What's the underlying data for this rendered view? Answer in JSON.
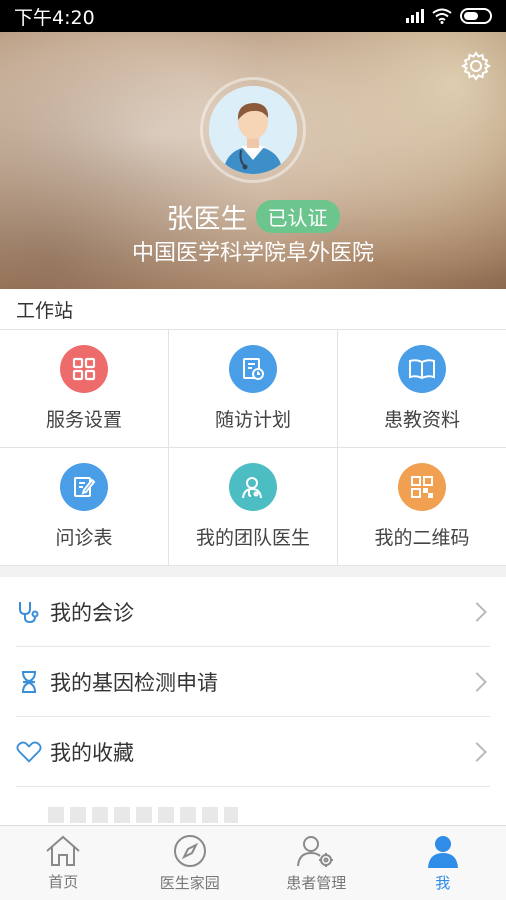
{
  "status_bar": {
    "time": "下午4:20"
  },
  "profile": {
    "name": "张医生",
    "badge": "已认证",
    "hospital": "中国医学科学院阜外医院"
  },
  "workstation": {
    "title": "工作站",
    "items": [
      {
        "label": "服务设置",
        "icon": "grid-icon",
        "color": "#ee6b6b"
      },
      {
        "label": "随访计划",
        "icon": "calendar-clock-icon",
        "color": "#4a9ee8"
      },
      {
        "label": "患教资料",
        "icon": "book-icon",
        "color": "#4a9ee8"
      },
      {
        "label": "问诊表",
        "icon": "edit-form-icon",
        "color": "#4a9ee8"
      },
      {
        "label": "我的团队医生",
        "icon": "doctor-team-icon",
        "color": "#4dbdc4"
      },
      {
        "label": "我的二维码",
        "icon": "qrcode-icon",
        "color": "#f0a050"
      }
    ]
  },
  "menu": {
    "items": [
      {
        "label": "我的会诊",
        "icon": "stethoscope-icon"
      },
      {
        "label": "我的基因检测申请",
        "icon": "dna-icon"
      },
      {
        "label": "我的收藏",
        "icon": "heart-icon"
      }
    ]
  },
  "tab_bar": {
    "items": [
      {
        "label": "首页",
        "icon": "home-icon"
      },
      {
        "label": "医生家园",
        "icon": "compass-icon"
      },
      {
        "label": "患者管理",
        "icon": "patient-manage-icon"
      },
      {
        "label": "我",
        "icon": "person-icon",
        "active": true
      }
    ],
    "active_color": "#2f8ce8"
  }
}
